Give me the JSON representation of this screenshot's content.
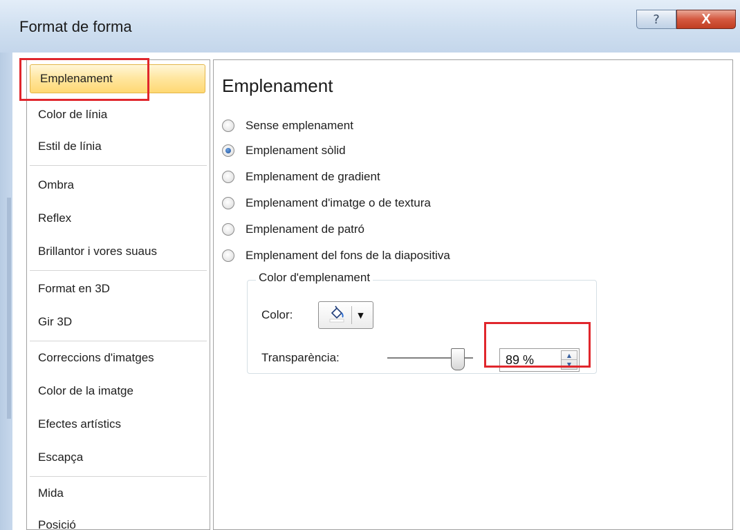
{
  "window": {
    "title": "Format de forma",
    "help_label": "?",
    "close_label": "X"
  },
  "nav": {
    "items": [
      {
        "label": "Emplenament",
        "selected": true
      },
      {
        "label": "Color de línia"
      },
      {
        "label": "Estil de línia"
      },
      {
        "label": "Ombra"
      },
      {
        "label": "Reflex"
      },
      {
        "label": "Brillantor i vores suaus"
      },
      {
        "label": "Format en 3D"
      },
      {
        "label": "Gir 3D"
      },
      {
        "label": "Correccions d'imatges"
      },
      {
        "label": "Color de la imatge"
      },
      {
        "label": "Efectes artístics"
      },
      {
        "label": "Escapça"
      },
      {
        "label": "Mida"
      },
      {
        "label": "Posició"
      }
    ]
  },
  "panel": {
    "title": "Emplenament",
    "options": [
      {
        "label": "Sense emplenament",
        "checked": false
      },
      {
        "label": "Emplenament sòlid",
        "checked": true
      },
      {
        "label": "Emplenament de gradient",
        "checked": false
      },
      {
        "label": "Emplenament d'imatge o de textura",
        "checked": false
      },
      {
        "label": "Emplenament de patró",
        "checked": false
      },
      {
        "label": "Emplenament del fons de la diapositiva",
        "checked": false
      }
    ],
    "fill_group": {
      "legend": "Color d'emplenament",
      "color_label": "Color:",
      "color_icon": "paint-bucket-icon",
      "transparency_label": "Transparència:",
      "transparency_value": "89 %",
      "transparency_fraction": 0.89
    }
  },
  "colors": {
    "highlight_red": "#e0262c",
    "selected_nav": "#ffd873",
    "close_button": "#c03e22"
  }
}
